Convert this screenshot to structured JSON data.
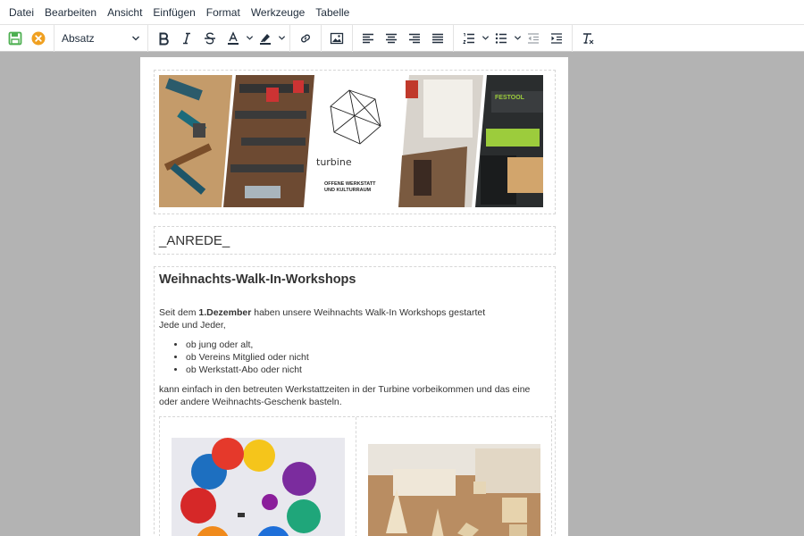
{
  "menubar": {
    "items": [
      "Datei",
      "Bearbeiten",
      "Ansicht",
      "Einfügen",
      "Format",
      "Werkzeuge",
      "Tabelle"
    ]
  },
  "toolbar": {
    "format_value": "Absatz",
    "save_color": "#4caf50",
    "cancel_color": "#f0a020"
  },
  "header_image": {
    "brand": "turbine",
    "tagline_line1": "OFFENE WERKSTATT",
    "tagline_line2": "UND KULTURRAUM",
    "tool_brand": "FESTOOL"
  },
  "anrede": "_ANREDE_",
  "content": {
    "title": "Weihnachts-Walk-In-Workshops",
    "intro_prefix": "Seit dem ",
    "intro_bold": "1.Dezember",
    "intro_suffix": " haben unsere Weihnachts Walk-In Workshops gestartet",
    "intro_line2": "Jede und Jeder,",
    "bullets": [
      "ob jung oder alt,",
      "ob Vereins Mitglied oder nicht",
      "ob Werkstatt-Abo oder nicht"
    ],
    "body": "kann einfach in den betreuten Werkstattzeiten in der Turbine vorbeikommen und das eine oder andere Weihnachts-Geschenk basteln."
  }
}
